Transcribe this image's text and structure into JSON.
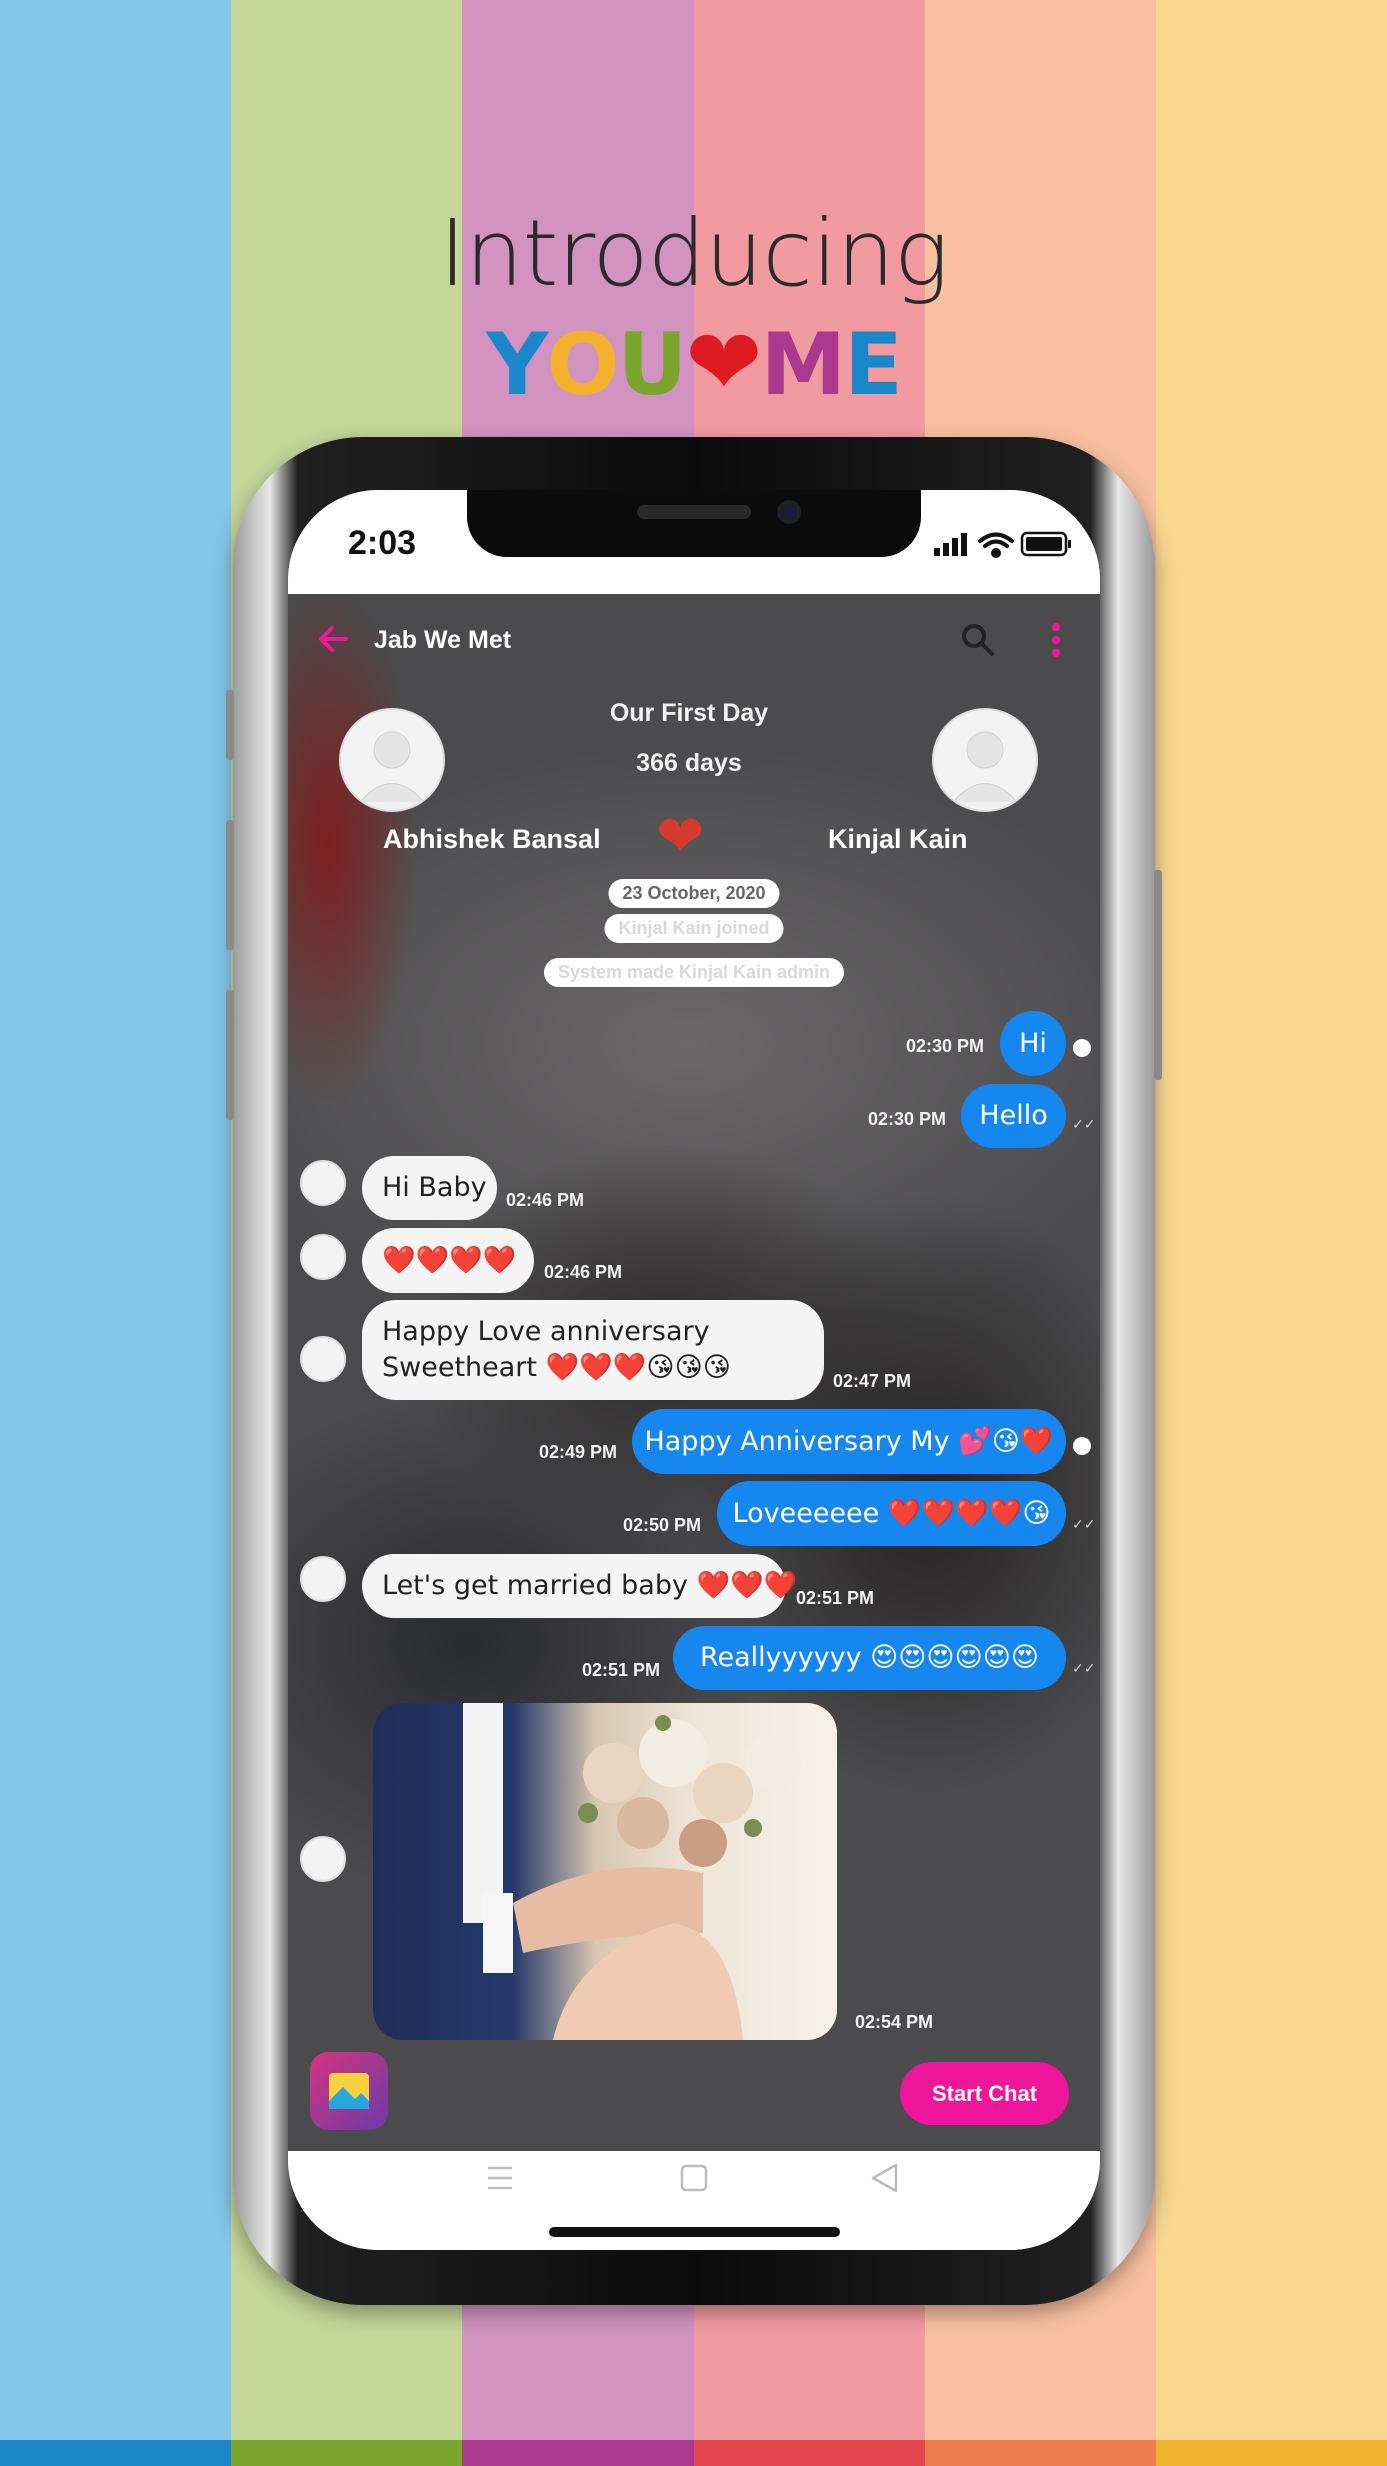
{
  "colors": {
    "stripes": [
      "#84c5e8",
      "#c3d597",
      "#d293c1",
      "#f19aa0",
      "#f8c0a0",
      "#f8d78f"
    ],
    "bands": [
      "#1a87c9",
      "#79a52d",
      "#a93a8e",
      "#e5474f",
      "#ef7e4f",
      "#f2b12f"
    ],
    "accent": "#f0169b",
    "outgoing_bubble": "#1787f0"
  },
  "promo": {
    "heading": "Introducing",
    "logo_letters": [
      "Y",
      "O",
      "U",
      "M",
      "E"
    ],
    "logo_heart": "❤"
  },
  "status_bar": {
    "time": "2:03",
    "icons": [
      "signal-icon",
      "wifi-icon",
      "battery-icon"
    ]
  },
  "header": {
    "title": "Jab We Met",
    "back_icon": "arrow-left-icon",
    "search_icon": "search-icon",
    "menu_icon": "more-vertical-icon"
  },
  "couple": {
    "title": "Our First Day",
    "days": "366 days",
    "left_name": "Abhishek Bansal",
    "right_name": "Kinjal Kain",
    "heart": "❤"
  },
  "system": {
    "date": "23 October, 2020",
    "joined": "Kinjal Kain joined",
    "admin": "System made Kinjal Kain admin"
  },
  "messages": [
    {
      "dir": "out",
      "text": "Hi",
      "time": "02:30 PM",
      "status": "sent"
    },
    {
      "dir": "out",
      "text": "Hello",
      "time": "02:30 PM",
      "status": "delivered"
    },
    {
      "dir": "in",
      "text": "Hi Baby",
      "time": "02:46 PM"
    },
    {
      "dir": "in",
      "text": "❤️❤️❤️❤️",
      "time": "02:46 PM"
    },
    {
      "dir": "in",
      "text": "Happy Love anniversary\nSweetheart ❤️❤️❤️😘😘😘",
      "time": "02:47 PM"
    },
    {
      "dir": "out",
      "text": "Happy Anniversary My 💕😘❤️",
      "time": "02:49 PM",
      "status": "sent"
    },
    {
      "dir": "out",
      "text": "Loveeeeee ❤️❤️❤️❤️😘",
      "time": "02:50 PM",
      "status": "delivered"
    },
    {
      "dir": "in",
      "text": "Let's get married baby ❤️❤️❤️",
      "time": "02:51 PM"
    },
    {
      "dir": "out",
      "text": "Reallyyyyyy 😍😍😍😍😍😍",
      "time": "02:51 PM",
      "status": "delivered"
    },
    {
      "dir": "in",
      "type": "image",
      "time": "02:54 PM"
    }
  ],
  "footer": {
    "start_chat": "Start Chat",
    "gallery_icon": "gallery-icon"
  },
  "nav": {
    "icons": [
      "menu-icon",
      "home-square-icon",
      "back-triangle-icon"
    ]
  }
}
